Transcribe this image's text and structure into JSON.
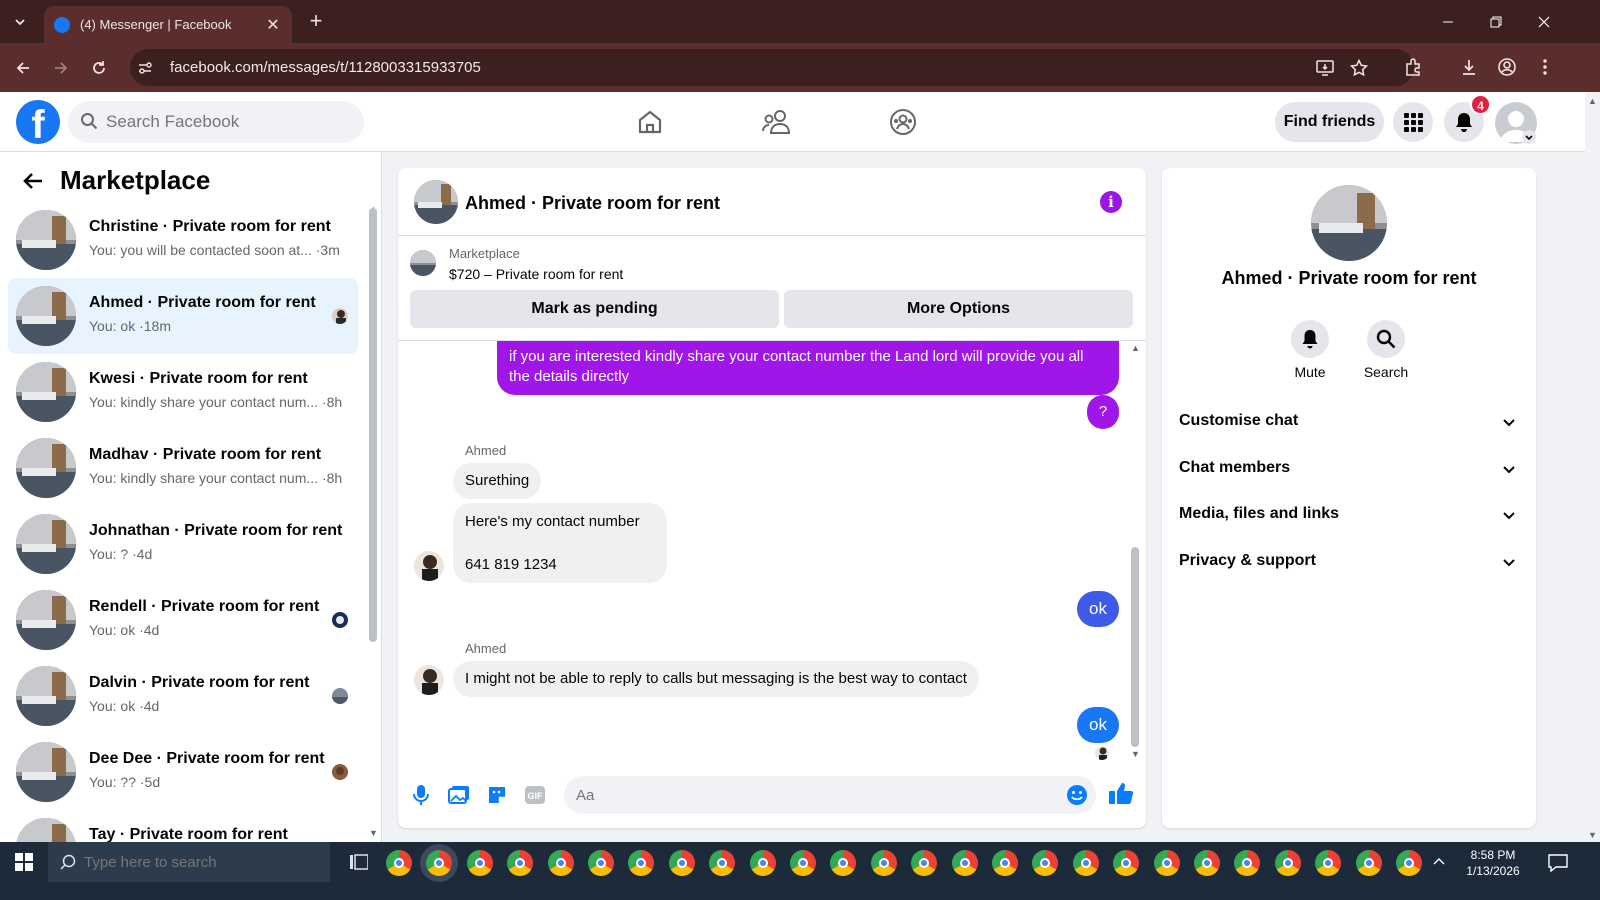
{
  "browser": {
    "tab_title": "(4) Messenger | Facebook",
    "tab_close": "✕",
    "new_tab": "+",
    "url": "facebook.com/messages/t/1128003315933705"
  },
  "fb": {
    "logo_letter": "f",
    "search_placeholder": "Search Facebook",
    "find_friends": "Find friends",
    "notification_count": "4"
  },
  "sidebar": {
    "title": "Marketplace",
    "conversations": [
      {
        "name": "Christine · Private room for rent",
        "preview": "You: you will be contacted soon at... ·3m"
      },
      {
        "name": "Ahmed · Private room for rent",
        "preview": "You: ok ·18m"
      },
      {
        "name": "Kwesi · Private room for rent",
        "preview": "You: kindly share your contact num... ·8h"
      },
      {
        "name": "Madhav · Private room for rent",
        "preview": "You: kindly share your contact num... ·8h"
      },
      {
        "name": "Johnathan · Private room for rent",
        "preview": "You: ? ·4d"
      },
      {
        "name": "Rendell · Private room for rent",
        "preview": "You: ok ·4d"
      },
      {
        "name": "Dalvin · Private room for rent",
        "preview": "You: ok ·4d"
      },
      {
        "name": "Dee Dee · Private room for rent",
        "preview": "You: ?? ·5d"
      },
      {
        "name": "Tay · Private room for rent",
        "preview": ""
      }
    ]
  },
  "chat": {
    "title": "Ahmed · Private room for rent",
    "info_glyph": "i",
    "marketplace_label": "Marketplace",
    "listing": "$720 – Private room for rent",
    "mark_pending": "Mark as pending",
    "more_options": "More Options",
    "messages": {
      "m1": "if you are interested kindly share your contact number the Land lord will provide you all the details directly",
      "m2": "?",
      "sender1": "Ahmed",
      "m3": "Surething",
      "m4a": "Here's my contact number",
      "m4b": "641 819 1234",
      "m5": "ok",
      "sender2": "Ahmed",
      "m6": "I might not be able to reply to calls but messaging is the best way to contact",
      "m7": "ok"
    },
    "composer_placeholder": "Aa"
  },
  "details": {
    "name": "Ahmed · Private room for rent",
    "mute": "Mute",
    "search": "Search",
    "sections": [
      "Customise chat",
      "Chat members",
      "Media, files and links",
      "Privacy & support"
    ]
  },
  "taskbar": {
    "search_placeholder": "Type here to search",
    "time": "8:58 PM",
    "date": "1/13/2026"
  }
}
